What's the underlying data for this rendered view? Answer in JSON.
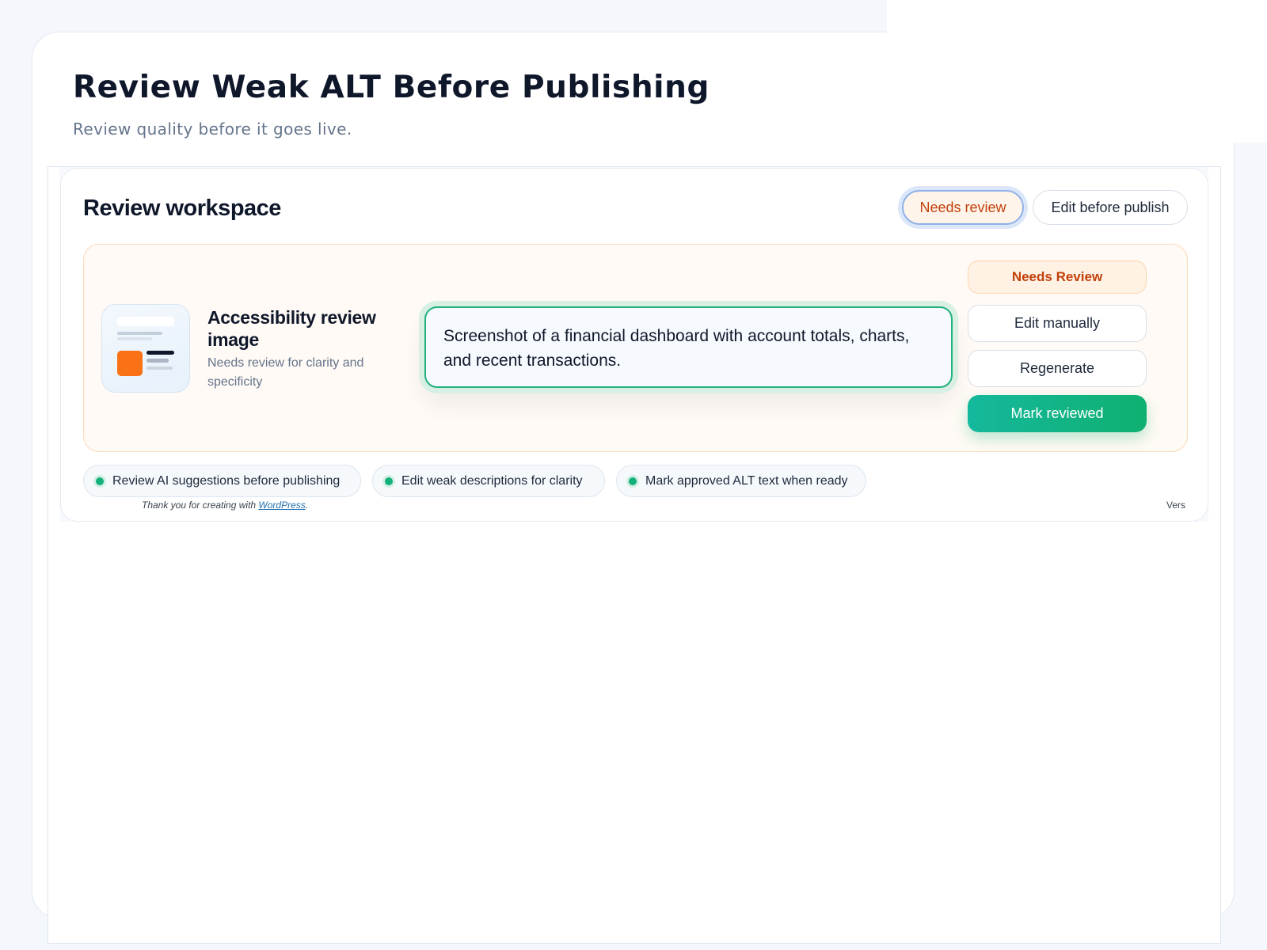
{
  "header": {
    "title": "Review Weak ALT Before Publishing",
    "subtitle": "Review quality before it goes live."
  },
  "workspace": {
    "title": "Review workspace",
    "tabs": [
      {
        "label": "Needs review",
        "active": true
      },
      {
        "label": "Edit before publish",
        "active": false
      }
    ]
  },
  "review_item": {
    "title": "Accessibility review image",
    "subtitle": "Needs review for clarity and specificity",
    "alt_text": "Screenshot of a financial dashboard with account totals, charts, and recent transactions.",
    "status": "Needs Review",
    "actions": {
      "edit": "Edit manually",
      "regenerate": "Regenerate",
      "mark": "Mark reviewed"
    }
  },
  "checklist": [
    {
      "label": "Review AI suggestions before publishing"
    },
    {
      "label": "Edit weak descriptions for clarity"
    },
    {
      "label": "Mark approved ALT text when ready"
    }
  ],
  "footer": {
    "thanks_prefix": "Thank you for creating with ",
    "link_text": "WordPress",
    "thanks_suffix": ".",
    "version": "Vers"
  },
  "colors": {
    "accent_green": "#12b07a",
    "warning_orange": "#c2410c",
    "thumb_orange": "#f97316",
    "link_blue": "#2271b1"
  },
  "icons": {
    "thumbnail": "dashboard-thumbnail-icon",
    "chip_dot": "status-dot-icon"
  }
}
